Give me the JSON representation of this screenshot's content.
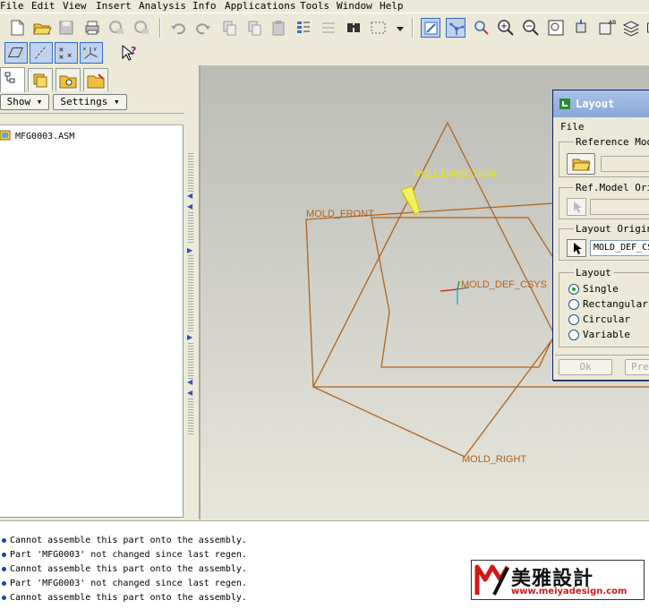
{
  "menu": [
    "File",
    "Edit",
    "View",
    "Insert",
    "Analysis",
    "Info",
    "Applications",
    "Tools",
    "Window",
    "Help"
  ],
  "left_panel": {
    "show_label": "Show",
    "settings_label": "Settings",
    "tree_root": "MFG0003.ASM"
  },
  "viewport": {
    "labels": {
      "pull_direction": "PULL DIRECTION",
      "mold_front": "MOLD_FRONT",
      "mold_def_csys": "MOLD_DEF_CSYS",
      "mold_right": "MOLD_RIGHT"
    },
    "colors": {
      "datum": "#b0621e",
      "pull": "#e8e800",
      "background_top": "#bcbcb7",
      "background_bottom": "#e6e6dc"
    }
  },
  "layout_dialog": {
    "title": "Layout",
    "menu_file": "File",
    "reference_model_label": "Reference Model",
    "ref_model_origin_label": "Ref.Model Origin",
    "layout_origin_label": "Layout Origin",
    "layout_origin_value": "MOLD_DEF_CSYS",
    "layout_group_label": "Layout",
    "options": [
      "Single",
      "Rectangular",
      "Circular",
      "Variable"
    ],
    "selected_option": "Single",
    "ok_label": "Ok",
    "preview_label": "Preview"
  },
  "messages": [
    "Cannot assemble this part onto the assembly.",
    "Part 'MFG0003' not changed since last regen.",
    "Cannot assemble this part onto the assembly.",
    "Part 'MFG0003' not changed since last regen.",
    "Cannot assemble this part onto the assembly."
  ],
  "watermark": {
    "brand": "美雅設計",
    "url": "www.meiyadesign.com"
  }
}
